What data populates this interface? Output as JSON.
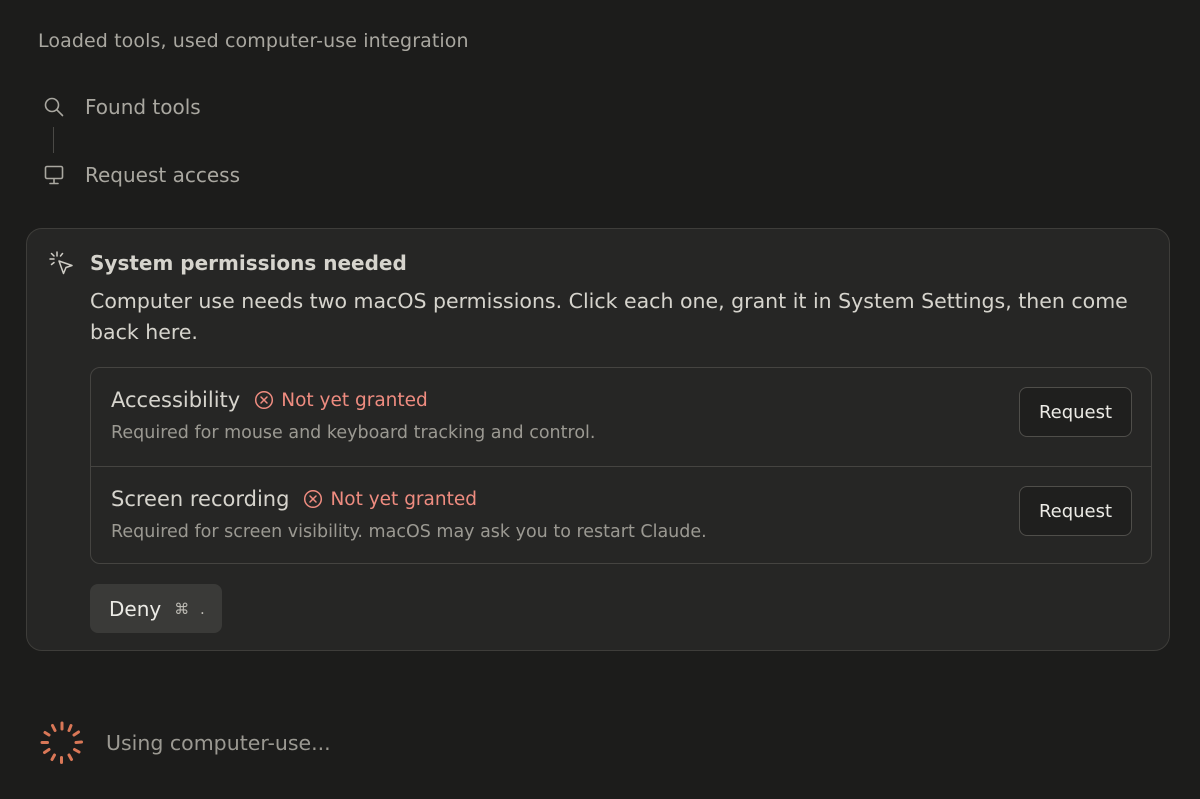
{
  "summary": "Loaded tools, used computer-use integration",
  "steps": [
    {
      "icon": "search-icon",
      "label": "Found tools"
    },
    {
      "icon": "monitor-icon",
      "label": "Request access"
    }
  ],
  "permissions_card": {
    "icon": "cursor-click-icon",
    "title": "System permissions needed",
    "description": "Computer use needs two macOS permissions. Click each one, grant it in System Settings, then come back here.",
    "items": [
      {
        "name": "Accessibility",
        "status": "Not yet granted",
        "description": "Required for mouse and keyboard tracking and control.",
        "button": "Request"
      },
      {
        "name": "Screen recording",
        "status": "Not yet granted",
        "description": "Required for screen visibility. macOS may ask you to restart Claude.",
        "button": "Request"
      }
    ],
    "deny": {
      "label": "Deny",
      "shortcut": "⌘ ."
    }
  },
  "running": {
    "icon": "spinner-icon",
    "label": "Using computer-use..."
  },
  "colors": {
    "background": "#1c1c1b",
    "card": "#262625",
    "status_error": "#ef8c80",
    "spinner": "#d97757"
  }
}
